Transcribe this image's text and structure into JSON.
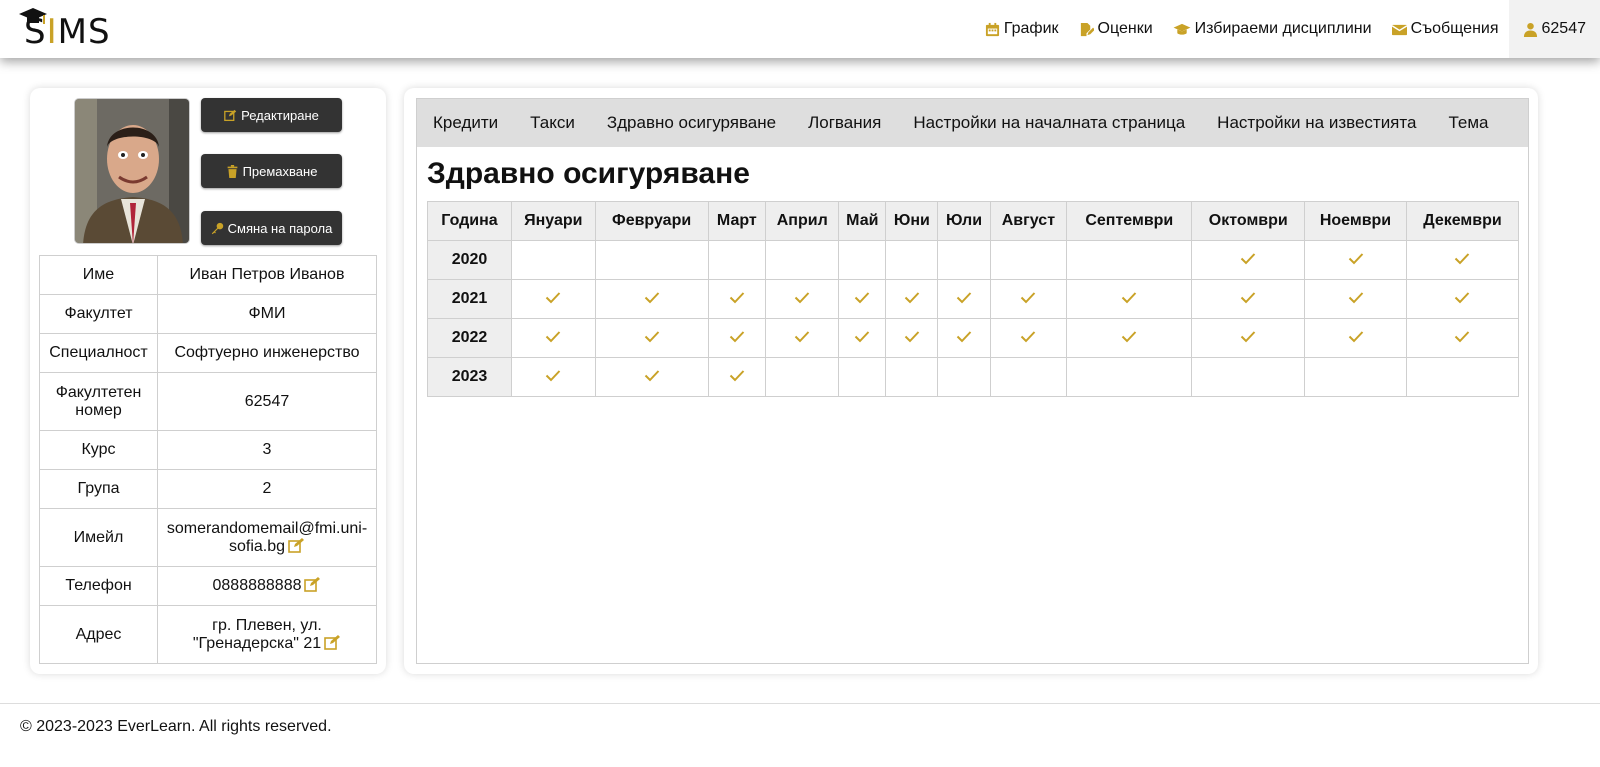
{
  "header": {
    "logo_text": "SIMS",
    "nav": [
      {
        "label": "График",
        "icon": "calendar-icon"
      },
      {
        "label": "Оценки",
        "icon": "file-pen-icon"
      },
      {
        "label": "Избираеми дисциплини",
        "icon": "graduation-cap-icon"
      },
      {
        "label": "Съобщения",
        "icon": "envelope-icon"
      },
      {
        "label": "62547",
        "icon": "user-icon"
      }
    ]
  },
  "profile": {
    "buttons": {
      "edit": "Редактиране",
      "remove": "Премахване",
      "change_password": "Смяна на парола"
    },
    "rows": [
      {
        "key": "Име",
        "value": "Иван Петров Иванов"
      },
      {
        "key": "Факултет",
        "value": "ФМИ"
      },
      {
        "key": "Специалност",
        "value": "Софтуерно инженерство"
      },
      {
        "key": "Факултетен номер",
        "value": "62547"
      },
      {
        "key": "Курс",
        "value": "3"
      },
      {
        "key": "Група",
        "value": "2"
      },
      {
        "key": "Имейл",
        "value": "somerandomemail@fmi.uni-sofia.bg"
      },
      {
        "key": "Телефон",
        "value": "0888888888"
      },
      {
        "key": "Адрес",
        "value": "гр. Плевен, ул. \"Гренадерска\" 21"
      }
    ]
  },
  "tabs": [
    "Кредити",
    "Такси",
    "Здравно осигуряване",
    "Логвания",
    "Настройки на началната страница",
    "Настройки на известията",
    "Тема"
  ],
  "insurance": {
    "title": "Здравно осигуряване",
    "headers": [
      "Година",
      "Януари",
      "Февруари",
      "Март",
      "Април",
      "Май",
      "Юни",
      "Юли",
      "Август",
      "Септември",
      "Октомври",
      "Ноември",
      "Декември"
    ],
    "rows": [
      {
        "year": "2020",
        "paid": [
          false,
          false,
          false,
          false,
          false,
          false,
          false,
          false,
          false,
          true,
          true,
          true
        ]
      },
      {
        "year": "2021",
        "paid": [
          true,
          true,
          true,
          true,
          true,
          true,
          true,
          true,
          true,
          true,
          true,
          true
        ]
      },
      {
        "year": "2022",
        "paid": [
          true,
          true,
          true,
          true,
          true,
          true,
          true,
          true,
          true,
          true,
          true,
          true
        ]
      },
      {
        "year": "2023",
        "paid": [
          true,
          true,
          true,
          false,
          false,
          false,
          false,
          false,
          false,
          false,
          false,
          false
        ]
      }
    ]
  },
  "colors": {
    "accent": "#c9a227",
    "button_bg": "#333333",
    "tab_bg": "#dedede"
  },
  "footer": {
    "text": "© 2023-2023 EverLearn. All rights reserved."
  }
}
